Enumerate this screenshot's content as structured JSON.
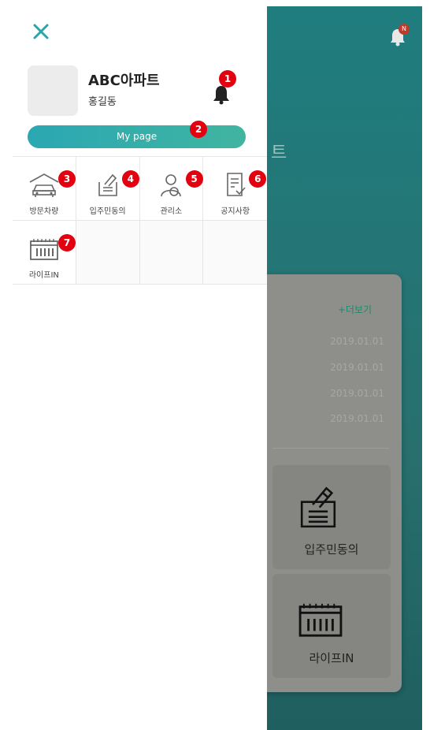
{
  "background": {
    "bell_badge": "N",
    "heading_fragment": "트",
    "more_link": "+더보기",
    "dates": [
      "2019.01.01",
      "2019.01.01",
      "2019.01.01",
      "2019.01.01"
    ],
    "tiles": [
      {
        "label": "입주민동의",
        "icon": "vote-box-icon"
      },
      {
        "label": "라이프IN",
        "icon": "calendar-icon"
      }
    ]
  },
  "drawer": {
    "close_icon": "close-icon",
    "apartment_name": "ABC아파트",
    "user_name": "홍길동",
    "mypage_label": "My page",
    "markers": {
      "bell": "1",
      "mypage": "2"
    },
    "menu": [
      {
        "label": "방문차량",
        "icon": "car-garage-icon",
        "marker": "3"
      },
      {
        "label": "입주민동의",
        "icon": "vote-box-icon",
        "marker": "4"
      },
      {
        "label": "관리소",
        "icon": "manager-icon",
        "marker": "5"
      },
      {
        "label": "공지사항",
        "icon": "notice-icon",
        "marker": "6"
      },
      {
        "label": "라이프IN",
        "icon": "calendar-icon",
        "marker": "7"
      }
    ]
  },
  "colors": {
    "accent": "#2aa6a8",
    "mypage_gradient_start": "#2aa7b3",
    "mypage_gradient_end": "#41b5a0",
    "marker_red": "#e3000f",
    "background_teal": "#1f7d7e"
  }
}
